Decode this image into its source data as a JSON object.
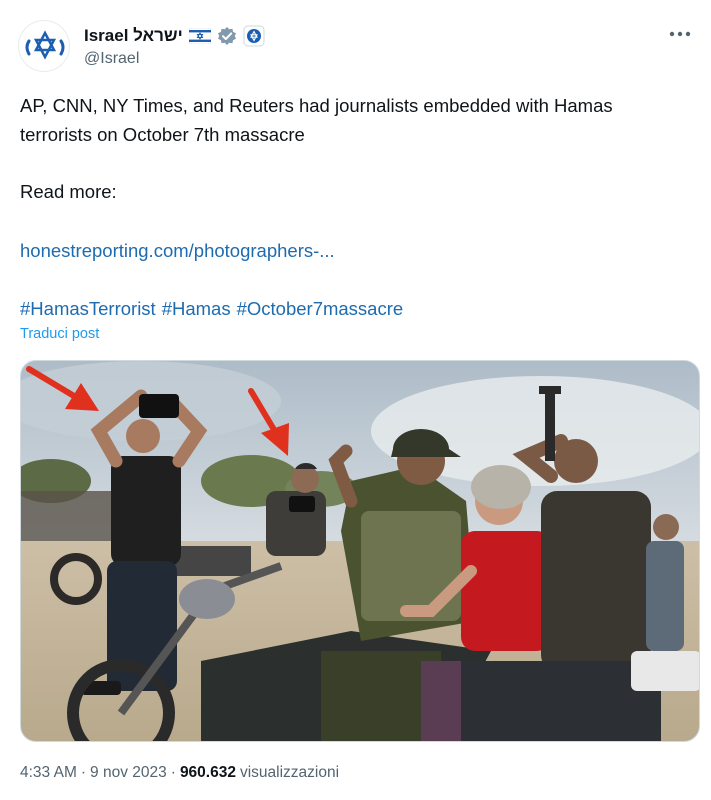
{
  "author": {
    "display_name": "Israel ישראל",
    "handle": "@Israel",
    "icons": [
      "israel-flag-icon",
      "verified-badge-icon",
      "government-affiliation-icon"
    ],
    "avatar_icon": "star-of-david-icon"
  },
  "tweet": {
    "line1": "AP, CNN, NY Times, and Reuters had journalists embedded with Hamas",
    "line2": "terrorists on October 7th massacre",
    "read_more": "Read more:",
    "link_text": "honestreporting.com/photographers-...",
    "hashtags": [
      "#HamasTerrorist",
      "#Hamas",
      "#October7massacre"
    ],
    "translate_label": "Traduci post"
  },
  "meta": {
    "time": "4:33 AM",
    "separator": "·",
    "date": "9 nov 2023",
    "views_count": "960.632",
    "views_label": "visualizzazioni"
  },
  "colors": {
    "link": "#1d6bb0",
    "translate": "#1d9bf0",
    "secondary_text": "#536471",
    "arrow": "#e0301e"
  }
}
